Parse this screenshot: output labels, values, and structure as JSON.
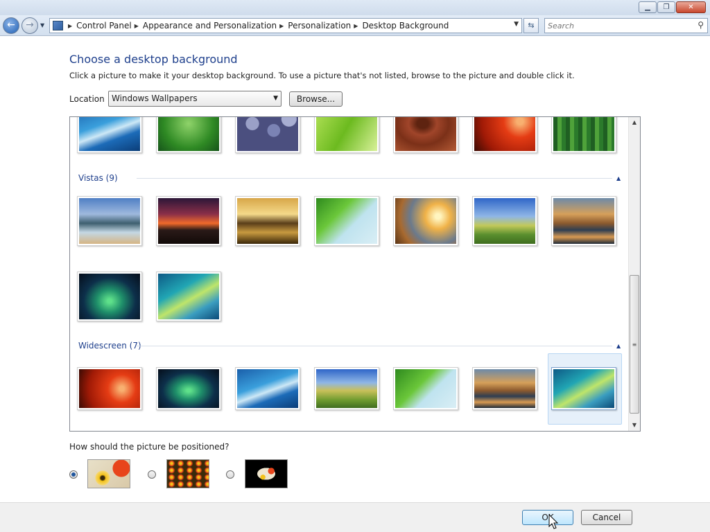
{
  "window": {
    "controls": {
      "minimize": "▁",
      "maximize": "❐",
      "close": "✕"
    }
  },
  "nav": {
    "breadcrumbs": [
      "Control Panel",
      "Appearance and Personalization",
      "Personalization",
      "Desktop Background"
    ],
    "search_placeholder": "Search",
    "icons": {
      "back": "back-arrow-icon",
      "forward": "forward-arrow-icon",
      "refresh": "refresh-icon",
      "search": "magnifier-icon"
    }
  },
  "page": {
    "title": "Choose a desktop background",
    "description": "Click a picture to make it your desktop background. To use a picture that's not listed, browse to the picture and double click it.",
    "location_label": "Location",
    "location_value": "Windows Wallpapers",
    "browse_label": "Browse..."
  },
  "gallery": {
    "groups": [
      {
        "label": "",
        "thumbnails": [
          "fish",
          "grass",
          "pebbles",
          "green-leaf",
          "wood",
          "red-flower",
          "bamboo"
        ]
      },
      {
        "label": "Vistas (9)",
        "thumbnails": [
          "mountain-lake",
          "sunset-purple",
          "rocks-golden",
          "palm-frond",
          "sunset-field",
          "green-hills",
          "canyon-reflection",
          "aurora",
          "vista-swoosh"
        ]
      },
      {
        "label": "Widescreen (7)",
        "thumbnails": [
          "red-flower",
          "aurora",
          "fish",
          "green-hills",
          "palm-frond",
          "canyon-reflection",
          "vista-swoosh"
        ]
      }
    ],
    "selected": "vista-swoosh"
  },
  "position": {
    "label": "How should the picture be positioned?",
    "options": [
      "Fill",
      "Tile",
      "Center"
    ],
    "selected": "Fill"
  },
  "footer": {
    "ok_label": "OK",
    "cancel_label": "Cancel"
  },
  "colors": {
    "heading": "#1e3f8c",
    "selection": "#e6f0fa",
    "accent": "#20569d"
  }
}
